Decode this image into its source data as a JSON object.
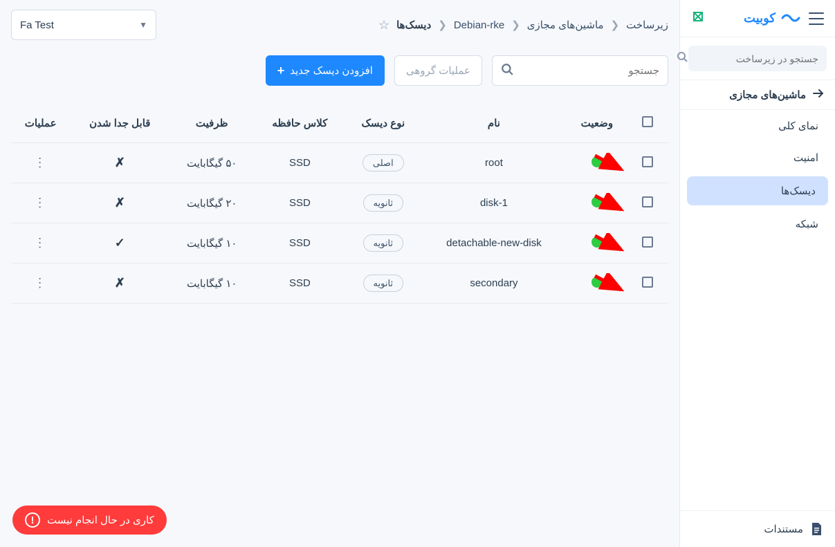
{
  "brand": {
    "name": "کوبیت"
  },
  "sidebar": {
    "search_placeholder": "جستجو در زیرساخت",
    "section_title": "ماشین‌های مجازی",
    "items": [
      {
        "label": "نمای کلی"
      },
      {
        "label": "امنیت"
      },
      {
        "label": "دیسک‌ها"
      },
      {
        "label": "شبکه"
      }
    ],
    "footer_label": "مستندات"
  },
  "breadcrumbs": {
    "items": [
      "زیرساخت",
      "ماشین‌های مجازی",
      "Debian-rke",
      "دیسک‌ها"
    ]
  },
  "selector": {
    "label": "Fa Test"
  },
  "toolbar": {
    "search_placeholder": "جستجو",
    "group_ops_label": "عملیات گروهی",
    "add_disk_label": "افزودن دیسک جدید"
  },
  "table": {
    "headers": {
      "status": "وضعیت",
      "name": "نام",
      "disk_type": "نوع دیسک",
      "storage_class": "کلاس حافظه",
      "capacity": "ظرفیت",
      "detachable": "قابل جدا شدن",
      "actions": "عملیات"
    },
    "rows": [
      {
        "name": "root",
        "type": "اصلی",
        "class": "SSD",
        "capacity": "۵۰ گیگابایت",
        "detachable": "✗"
      },
      {
        "name": "disk-1",
        "type": "ثانویه",
        "class": "SSD",
        "capacity": "۲۰ گیگابایت",
        "detachable": "✗"
      },
      {
        "name": "detachable-new-disk",
        "type": "ثانویه",
        "class": "SSD",
        "capacity": "۱۰ گیگابایت",
        "detachable": "✓"
      },
      {
        "name": "secondary",
        "type": "ثانویه",
        "class": "SSD",
        "capacity": "۱۰ گیگابایت",
        "detachable": "✗"
      }
    ]
  },
  "no_job_label": "کاری در حال انجام نیست",
  "icons": {
    "hamburger": "menu-icon",
    "wave": "wave-icon",
    "secondary_logo": "secondary-logo-icon",
    "search": "search-icon",
    "arrow_right": "arrow-right-icon",
    "star": "star-icon",
    "caret": "caret-down-icon",
    "plus": "plus-icon",
    "doc": "document-icon",
    "alert": "alert-icon"
  }
}
